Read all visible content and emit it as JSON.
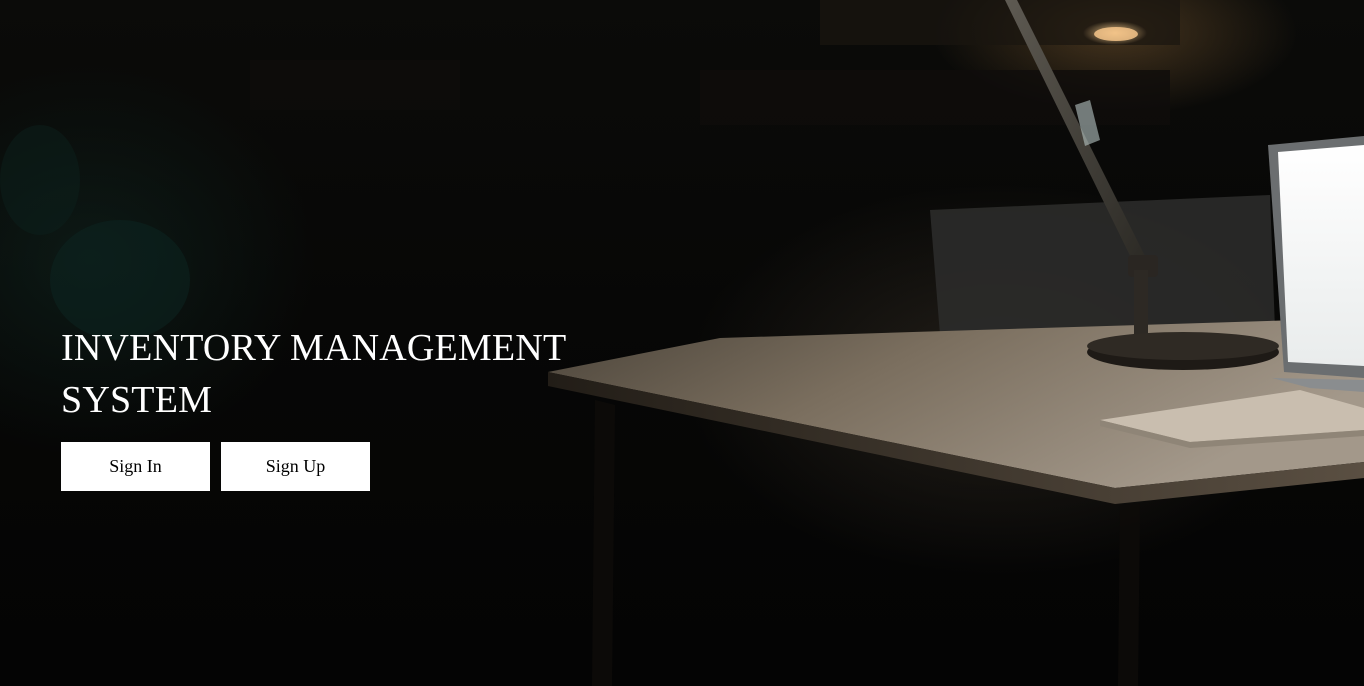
{
  "hero": {
    "title": "INVENTORY MANAGEMENT SYSTEM",
    "background_image": "dark-desk-with-lamp-and-laptop"
  },
  "actions": {
    "sign_in_label": "Sign In",
    "sign_up_label": "Sign Up"
  },
  "colors": {
    "background": "#050505",
    "title_text": "#ffffff",
    "button_background": "#ffffff",
    "button_text": "#000000"
  }
}
